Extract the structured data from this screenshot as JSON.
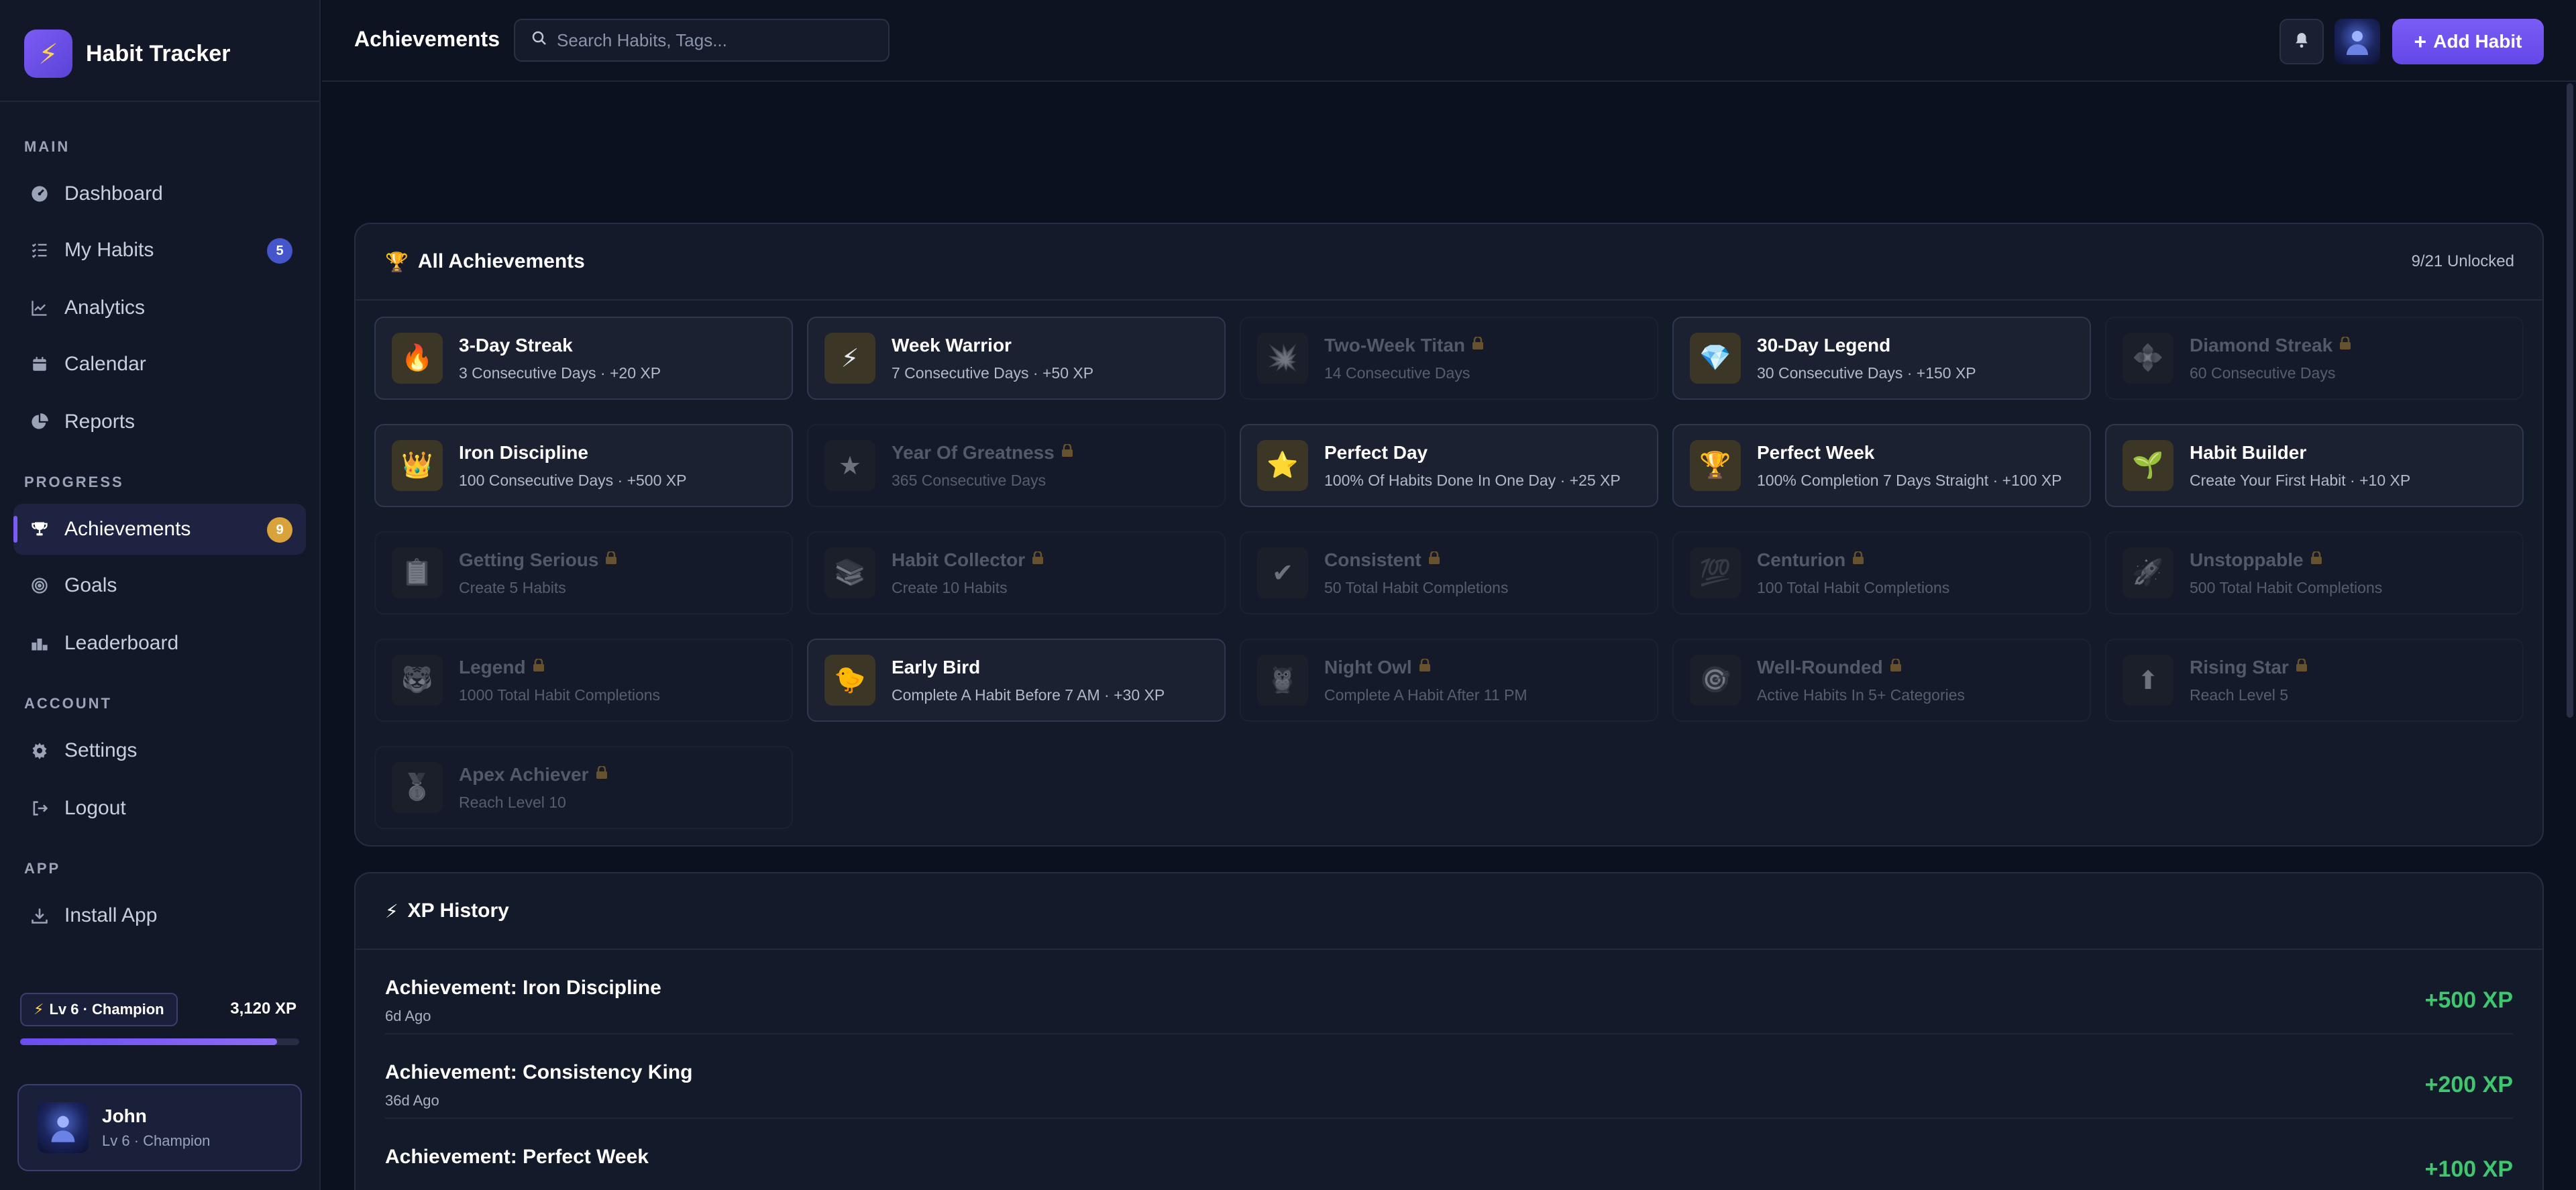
{
  "app": {
    "name": "Habit Tracker"
  },
  "sidebar": {
    "sections": {
      "main": "MAIN",
      "progress": "PROGRESS",
      "account": "ACCOUNT",
      "app": "APP"
    },
    "items": {
      "dashboard": {
        "label": "Dashboard",
        "icon": "dashboard-icon"
      },
      "my_habits": {
        "label": "My Habits",
        "icon": "list-check-icon",
        "badge": "5"
      },
      "analytics": {
        "label": "Analytics",
        "icon": "chart-line-icon"
      },
      "calendar": {
        "label": "Calendar",
        "icon": "calendar-icon"
      },
      "reports": {
        "label": "Reports",
        "icon": "pie-chart-icon"
      },
      "achievements": {
        "label": "Achievements",
        "icon": "trophy-icon",
        "badge": "9",
        "active": true
      },
      "goals": {
        "label": "Goals",
        "icon": "target-icon"
      },
      "leaderboard": {
        "label": "Leaderboard",
        "icon": "podium-icon"
      },
      "settings": {
        "label": "Settings",
        "icon": "gear-icon"
      },
      "logout": {
        "label": "Logout",
        "icon": "logout-icon"
      },
      "install": {
        "label": "Install App",
        "icon": "download-icon"
      }
    },
    "level": {
      "label": "Lv 6 · Champion",
      "xp": "3,120 XP",
      "progress": 0.92
    },
    "user": {
      "name": "John",
      "subtitle": "Lv 6 · Champion"
    }
  },
  "topbar": {
    "title": "Achievements",
    "search_placeholder": "Search Habits, Tags...",
    "add_button": "Add Habit"
  },
  "achievements": {
    "title": "All Achievements",
    "unlocked_count": "9/21 Unlocked",
    "items": [
      {
        "name": "3-Day Streak",
        "desc": "3 Consecutive Days · +20 XP",
        "icon": "🔥",
        "locked": false
      },
      {
        "name": "Week Warrior",
        "desc": "7 Consecutive Days · +50 XP",
        "icon": "⚡",
        "locked": false
      },
      {
        "name": "Two-Week Titan",
        "desc": "14 Consecutive Days",
        "icon": "💥",
        "locked": true
      },
      {
        "name": "30-Day Legend",
        "desc": "30 Consecutive Days · +150 XP",
        "icon": "💎",
        "locked": false
      },
      {
        "name": "Diamond Streak",
        "desc": "60 Consecutive Days",
        "icon": "💠",
        "locked": true
      },
      {
        "name": "Iron Discipline",
        "desc": "100 Consecutive Days · +500 XP",
        "icon": "👑",
        "locked": false
      },
      {
        "name": "Year Of Greatness",
        "desc": "365 Consecutive Days",
        "icon": "★",
        "locked": true
      },
      {
        "name": "Perfect Day",
        "desc": "100% Of Habits Done In One Day · +25 XP",
        "icon": "⭐",
        "locked": false
      },
      {
        "name": "Perfect Week",
        "desc": "100% Completion 7 Days Straight · +100 XP",
        "icon": "🏆",
        "locked": false
      },
      {
        "name": "Habit Builder",
        "desc": "Create Your First Habit · +10 XP",
        "icon": "🌱",
        "locked": false
      },
      {
        "name": "Getting Serious",
        "desc": "Create 5 Habits",
        "icon": "📋",
        "locked": true
      },
      {
        "name": "Habit Collector",
        "desc": "Create 10 Habits",
        "icon": "📚",
        "locked": true
      },
      {
        "name": "Consistent",
        "desc": "50 Total Habit Completions",
        "icon": "✔",
        "locked": true
      },
      {
        "name": "Centurion",
        "desc": "100 Total Habit Completions",
        "icon": "💯",
        "locked": true
      },
      {
        "name": "Unstoppable",
        "desc": "500 Total Habit Completions",
        "icon": "🚀",
        "locked": true
      },
      {
        "name": "Legend",
        "desc": "1000 Total Habit Completions",
        "icon": "🐯",
        "locked": true
      },
      {
        "name": "Early Bird",
        "desc": "Complete A Habit Before 7 AM · +30 XP",
        "icon": "🐤",
        "locked": false
      },
      {
        "name": "Night Owl",
        "desc": "Complete A Habit After 11 PM",
        "icon": "🦉",
        "locked": true
      },
      {
        "name": "Well-Rounded",
        "desc": "Active Habits In 5+ Categories",
        "icon": "🎯",
        "locked": true
      },
      {
        "name": "Rising Star",
        "desc": "Reach Level 5",
        "icon": "⬆",
        "locked": true
      },
      {
        "name": "Apex Achiever",
        "desc": "Reach Level 10",
        "icon": "🥇",
        "locked": true
      }
    ]
  },
  "xp_history": {
    "title": "XP History",
    "rows": [
      {
        "title": "Achievement: Iron Discipline",
        "time": "6d Ago",
        "amount": "+500 XP"
      },
      {
        "title": "Achievement: Consistency King",
        "time": "36d Ago",
        "amount": "+200 XP"
      },
      {
        "title": "Achievement: Perfect Week",
        "time": "",
        "amount": "+100 XP"
      }
    ]
  }
}
